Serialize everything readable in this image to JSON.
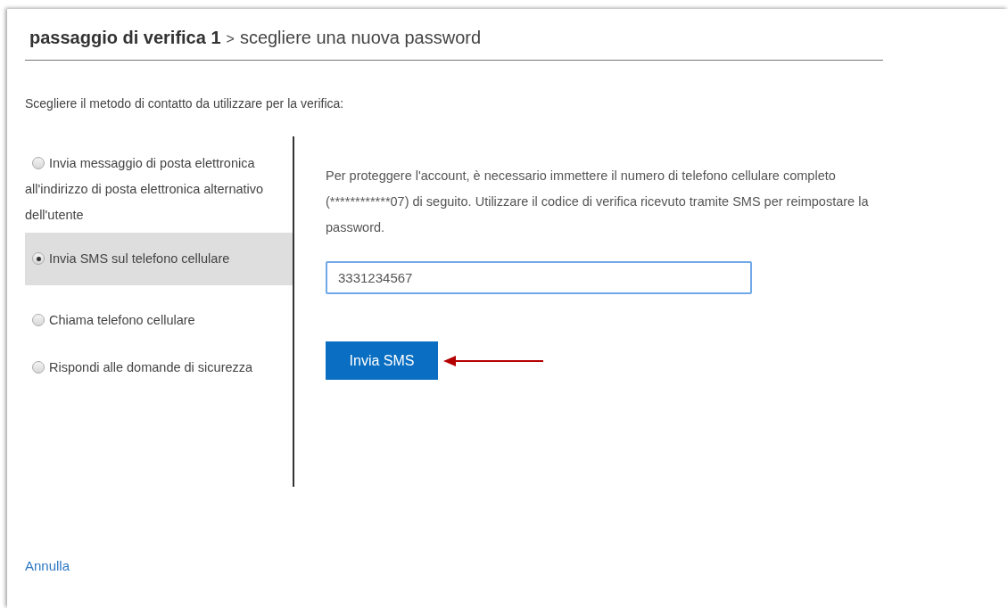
{
  "title": {
    "step": "passaggio di verifica 1",
    "separator": ">",
    "current": "scegliere una nuova password"
  },
  "instruction": "Scegliere il metodo di contatto da utilizzare per la verifica:",
  "methods": [
    {
      "label": "Invia messaggio di posta elettronica all'indirizzo di posta elettronica alternativo dell'utente",
      "selected": false
    },
    {
      "label": "Invia SMS sul telefono cellulare",
      "selected": true
    },
    {
      "label": "Chiama telefono cellulare",
      "selected": false
    },
    {
      "label": "Rispondi alle domande di sicurezza",
      "selected": false
    }
  ],
  "description": "Per proteggere l'account, è necessario immettere il numero di telefono cellulare completo (************07) di seguito. Utilizzare il codice di verifica ricevuto tramite SMS per reimpostare la password.",
  "phone_field": {
    "value": "3331234567"
  },
  "send_button": "Invia SMS",
  "cancel_link": "Annulla"
}
